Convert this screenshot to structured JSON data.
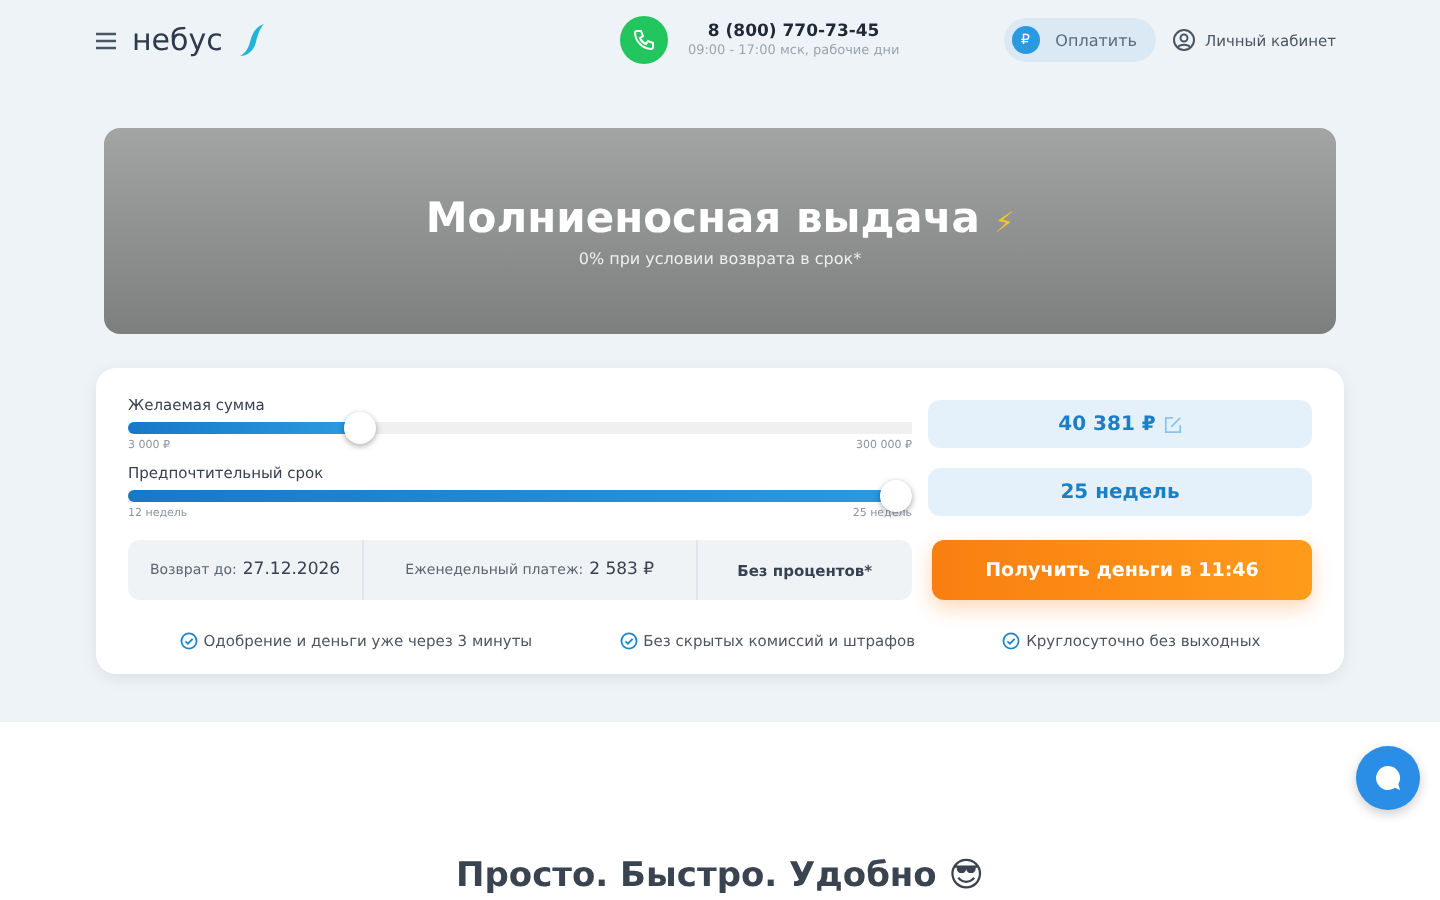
{
  "header": {
    "logo": "небус",
    "phone": "8 (800) 770-73-45",
    "hours": "09:00 - 17:00 мск, рабочие дни",
    "pay_button": "Оплатить",
    "pay_badge": "₽",
    "account_link": "Личный кабинет"
  },
  "banner": {
    "title": "Молниеносная выдача",
    "emoji": "⚡",
    "subtitle": "0% при условии возврата в срок*"
  },
  "sliders": [
    {
      "label": "Желаемая сумма",
      "level": 0.286,
      "min": "3 000 ₽",
      "max": "300 000 ₽",
      "value": "40 381 ₽",
      "editable": true
    },
    {
      "label": "Предпочтительный срок",
      "level": 1,
      "min": "12 недель",
      "max": "25 недель",
      "value": "25 недель",
      "editable": false
    }
  ],
  "summary": [
    {
      "label": "Возврат до:",
      "value": "27.12.2026"
    },
    {
      "label": "Еженедельный платеж:",
      "value": "2 583 ₽"
    },
    {
      "value": "Без процентов*"
    }
  ],
  "cta": "Получить деньги в 11:46",
  "features": [
    "Одобрение и деньги уже через 3 минуты",
    "Без скрытых комиссий и штрафов",
    "Круглосуточно без выходных"
  ],
  "section_title": "Просто. Быстро. Удобно 😎"
}
